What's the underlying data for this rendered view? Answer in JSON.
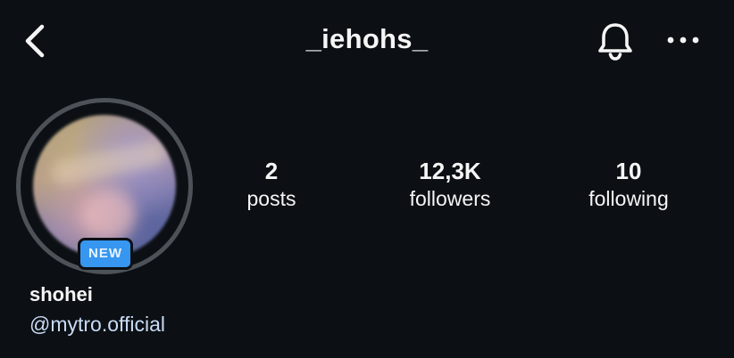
{
  "header": {
    "back_icon": "chevron-left-icon",
    "username": "_iehohs_",
    "bell_icon": "bell-icon",
    "more_icon": "more-horizontal-icon"
  },
  "profile": {
    "avatar_badge": "NEW",
    "display_name": "shohei",
    "handle": "@mytro.official"
  },
  "stats": {
    "posts": {
      "value": "2",
      "label": "posts"
    },
    "followers": {
      "value": "12,3K",
      "label": "followers"
    },
    "following": {
      "value": "10",
      "label": "following"
    }
  },
  "colors": {
    "background": "#0c1014",
    "text": "#f5f5f5",
    "ring": "#4c5258",
    "badge": "#3797f0",
    "link": "#c9dbf5"
  }
}
